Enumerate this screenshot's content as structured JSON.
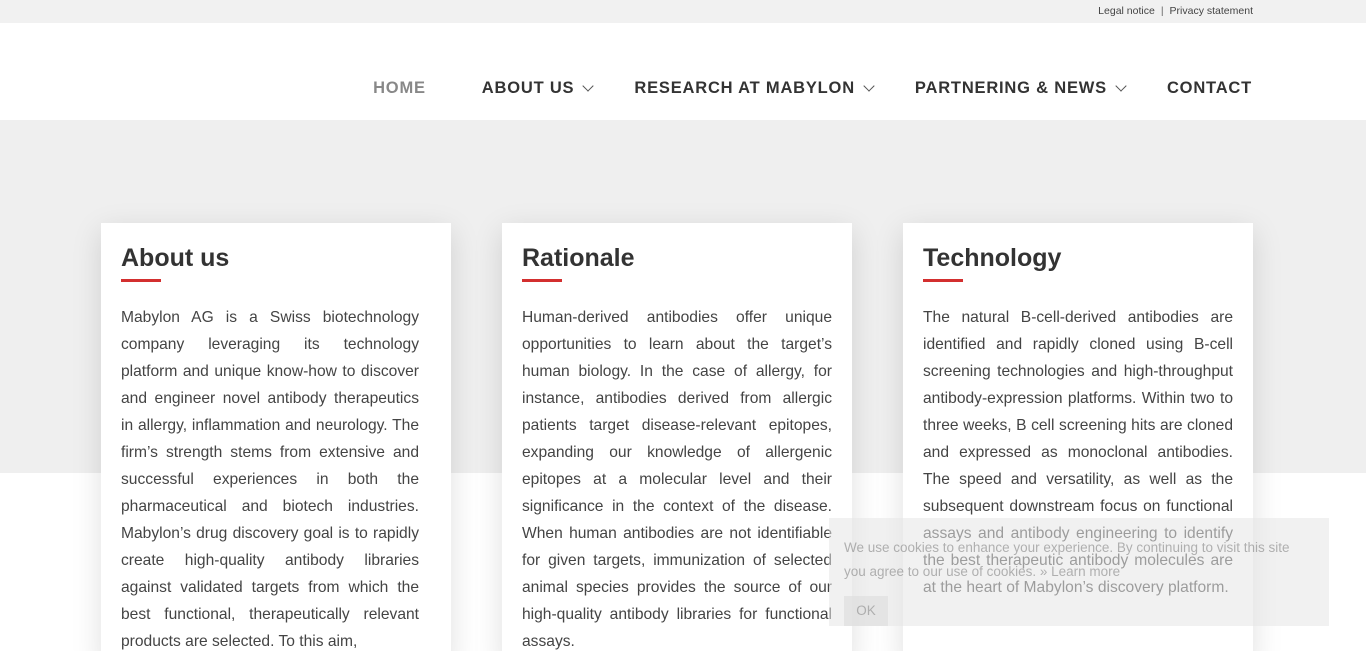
{
  "toplinks": {
    "legal": "Legal notice",
    "separator": "|",
    "privacy": "Privacy statement"
  },
  "nav": {
    "home": "HOME",
    "about": "ABOUT US",
    "research": "RESEARCH AT MABYLON",
    "partnering": "PARTNERING & NEWS",
    "contact": "CONTACT"
  },
  "cards": [
    {
      "title": "About us",
      "text": "Mabylon AG is a Swiss biotechnology company leveraging its technology platform and unique know-how to discover and engineer novel antibody therapeutics in allergy, inflammation and neurology. The firm’s strength stems from extensive and successful experiences in both the pharmaceutical and biotech industries. Mabylon’s drug discovery goal is to rapidly create high-quality antibody libraries against validated targets from which the best functional, therapeutically relevant products are selected. To this aim,"
    },
    {
      "title": "Rationale",
      "text": "Human-derived antibodies offer unique opportunities to learn about the target’s human biology. In the case of allergy, for instance, antibodies derived from allergic patients target disease-relevant epitopes, expanding our knowledge of allergenic epitopes at a molecular level and their significance in the context of the disease. When human antibodies are not identifiable for given targets, immunization of selected animal species provides the source of our high-quality antibody libraries for functional assays."
    },
    {
      "title": "Technology",
      "text": "The natural B-cell-derived antibodies are identified and rapidly cloned using B-cell screening technologies and high-throughput antibody-expression platforms. Within two to three weeks, B cell screening hits are cloned and expressed as monoclonal antibodies. The speed and versatility, as well as the subsequent downstream focus on functional assays and antibody engineering to identify the best therapeutic antibody molecules are at the heart of Mabylon’s discovery platform."
    }
  ],
  "cookie": {
    "message": "We use cookies to enhance your experience. By continuing to visit this site you agree to our use of cookies.",
    "learn_more": "» Learn more",
    "ok": "OK"
  },
  "colors": {
    "accent": "#d32f2f",
    "band": "#efefef",
    "topbar": "#f1f1f1"
  }
}
